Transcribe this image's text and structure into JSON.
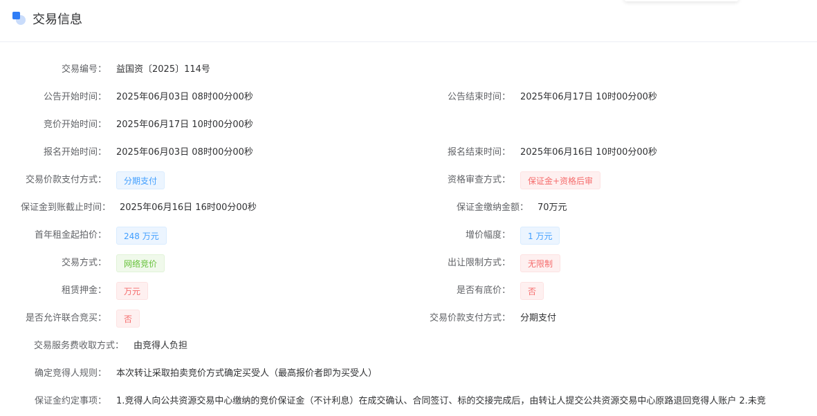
{
  "header": {
    "title": "交易信息"
  },
  "fields": {
    "trade_no": {
      "label": "交易编号：",
      "value": "益国资〔2025〕114号"
    },
    "notice_start": {
      "label": "公告开始时间：",
      "value": "2025年06月03日 08时00分00秒"
    },
    "notice_end": {
      "label": "公告结束时间：",
      "value": "2025年06月17日 10时00分00秒"
    },
    "bid_start": {
      "label": "竞价开始时间：",
      "value": "2025年06月17日 10时00分00秒"
    },
    "signup_start": {
      "label": "报名开始时间：",
      "value": "2025年06月03日 08时00分00秒"
    },
    "signup_end": {
      "label": "报名结束时间：",
      "value": "2025年06月16日 10时00分00秒"
    },
    "payment_method": {
      "label": "交易价款支付方式：",
      "value": "分期支付"
    },
    "qualification_review": {
      "label": "资格审查方式：",
      "value": "保证金+资格后审"
    },
    "deposit_deadline": {
      "label": "保证金到账截止时间：",
      "value": "2025年06月16日 16时00分00秒"
    },
    "deposit_amount": {
      "label": "保证金缴纳金额：",
      "value": "70万元"
    },
    "first_year_rent": {
      "label": "首年租金起拍价：",
      "value": "248 万元"
    },
    "increment": {
      "label": "增价幅度：",
      "value": "1 万元"
    },
    "trade_mode": {
      "label": "交易方式：",
      "value": "网络竞价"
    },
    "transfer_limit": {
      "label": "出让限制方式：",
      "value": "无限制"
    },
    "lease_deposit": {
      "label": "租赁押金：",
      "value": "万元"
    },
    "reserve_price": {
      "label": "是否有底价：",
      "value": "否"
    },
    "joint_bid": {
      "label": "是否允许联合竞买：",
      "value": "否"
    },
    "payment_method_2": {
      "label": "交易价款支付方式：",
      "value": "分期支付"
    },
    "service_fee": {
      "label": "交易服务费收取方式：",
      "value": "由竞得人负担"
    },
    "winner_rule": {
      "label": "确定竞得人规则：",
      "value": "本次转让采取拍卖竞价方式确定买受人（最高报价者即为买受人）"
    },
    "deposit_terms": {
      "label": "保证金约定事项：",
      "value": "1.竞得人向公共资源交易中心缴纳的竞价保证金（不计利息）在成交确认、合同签订、标的交接完成后，由转让人提交公共资源交易中心原路退回竞得人账户 2.未竞"
    }
  },
  "colors": {
    "accent": "#409eff",
    "danger": "#f56c6c",
    "success": "#67c23a"
  }
}
